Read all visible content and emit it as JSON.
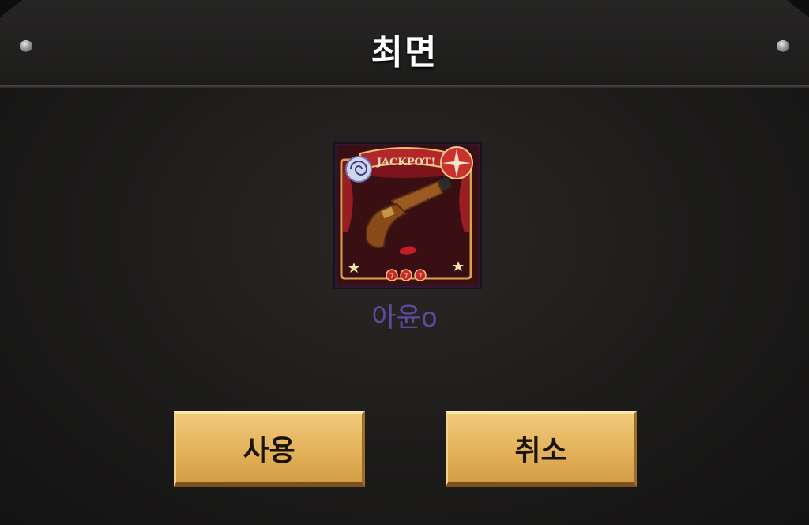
{
  "dialog": {
    "title": "최면"
  },
  "item": {
    "name": "아윤o",
    "banner_text": "JACKPOT!",
    "badge_digits": [
      "7",
      "7",
      "7"
    ],
    "name_color": "#5c4b9c",
    "icon": "flintlock-pistol-card"
  },
  "buttons": {
    "use_label": "사용",
    "cancel_label": "취소"
  },
  "colors": {
    "button_gold": "#e5b45d",
    "card_curtain": "#8b1a1f"
  }
}
